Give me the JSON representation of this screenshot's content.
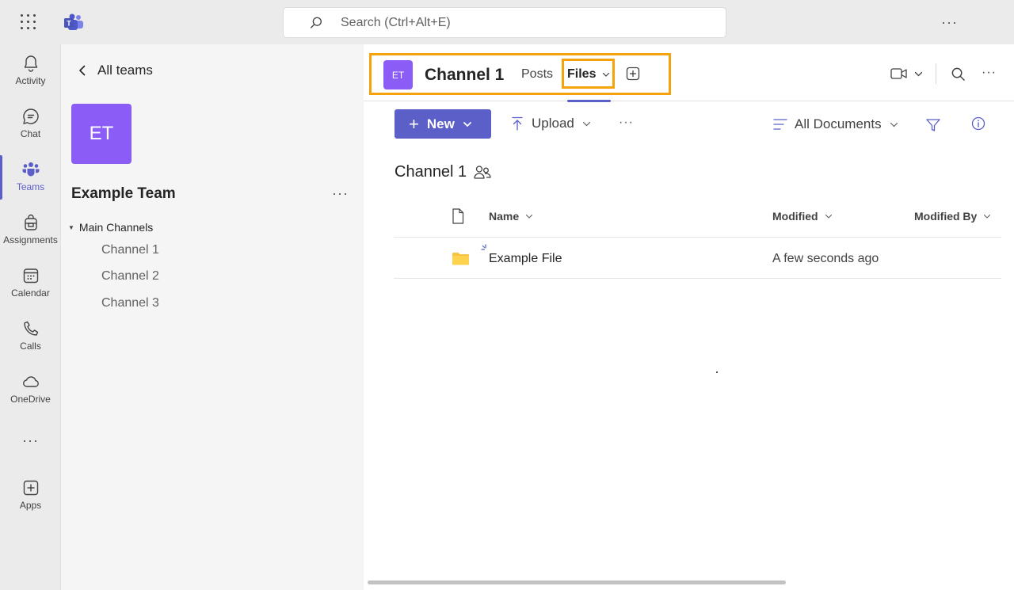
{
  "topbar": {
    "search_placeholder": "Search (Ctrl+Alt+E)",
    "more": "···"
  },
  "rail": {
    "items": [
      {
        "label": "Activity",
        "icon": "bell-icon"
      },
      {
        "label": "Chat",
        "icon": "chat-icon"
      },
      {
        "label": "Teams",
        "icon": "teams-icon",
        "active": true
      },
      {
        "label": "Assignments",
        "icon": "backpack-icon"
      },
      {
        "label": "Calendar",
        "icon": "calendar-icon"
      },
      {
        "label": "Calls",
        "icon": "phone-icon"
      },
      {
        "label": "OneDrive",
        "icon": "cloud-icon"
      },
      {
        "label": "Apps",
        "icon": "add-app-icon"
      }
    ],
    "more": "···"
  },
  "team_panel": {
    "back_label": "All teams",
    "avatar_initials": "ET",
    "team_name": "Example Team",
    "more": "···",
    "section_label": "Main Channels",
    "channels": [
      "Channel 1",
      "Channel 2",
      "Channel 3"
    ]
  },
  "channel_header": {
    "avatar_initials": "ET",
    "title": "Channel 1",
    "tabs": [
      "Posts",
      "Files"
    ],
    "active_tab": "Files",
    "more": "···"
  },
  "toolbar": {
    "new_label": "New",
    "upload_label": "Upload",
    "more": "···",
    "view_label": "All Documents"
  },
  "library": {
    "title": "Channel 1",
    "columns": [
      "Name",
      "Modified",
      "Modified By"
    ],
    "rows": [
      {
        "name": "Example File",
        "modified": "A few seconds ago",
        "modified_by": ""
      }
    ]
  },
  "colors": {
    "accent": "#5b5fc7",
    "avatar": "#8b5cf6",
    "highlight": "#f5a20c"
  }
}
